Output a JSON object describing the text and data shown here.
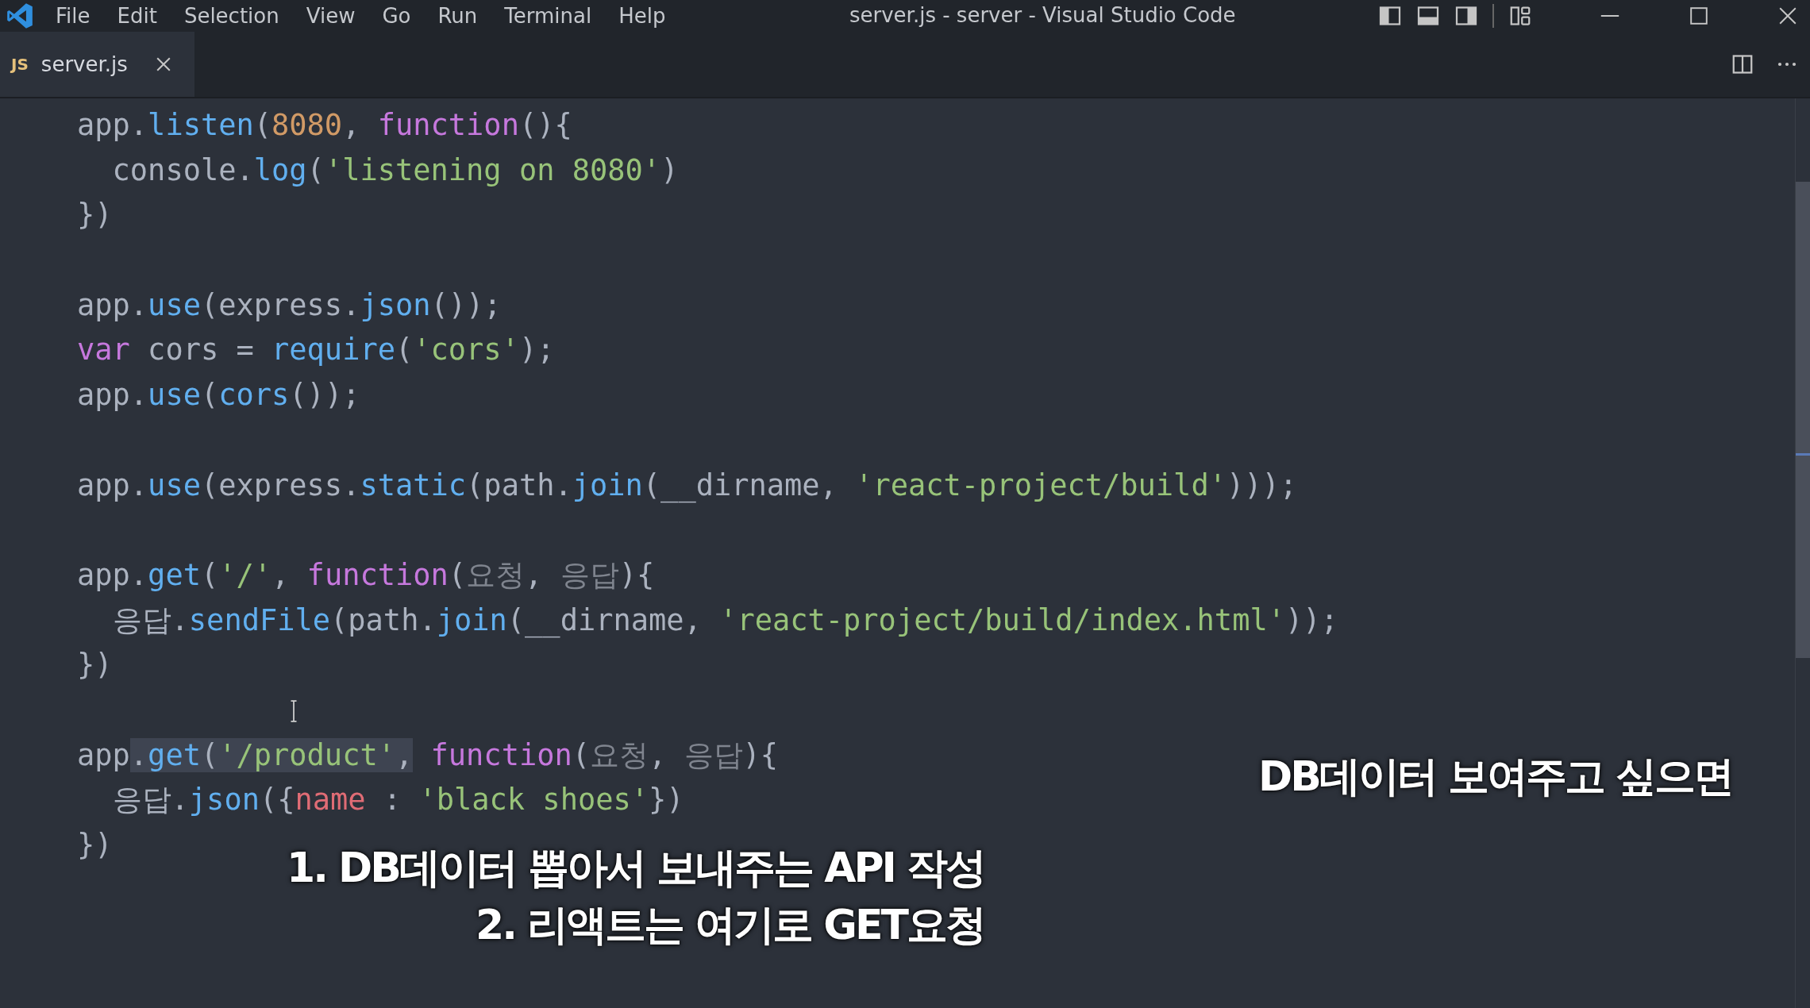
{
  "window": {
    "title": "server.js - server - Visual Studio Code"
  },
  "menu": [
    "File",
    "Edit",
    "Selection",
    "View",
    "Go",
    "Run",
    "Terminal",
    "Help"
  ],
  "tabs": [
    {
      "label": "server.js",
      "badge": "JS",
      "selected": true
    }
  ],
  "editor": {
    "lines": [
      {
        "kind": "code",
        "tokens": [
          {
            "kind": "plain",
            "text": "app."
          },
          {
            "kind": "fn",
            "text": "listen"
          },
          {
            "kind": "plain",
            "text": "("
          },
          {
            "kind": "num",
            "text": "8080"
          },
          {
            "kind": "plain",
            "text": ", "
          },
          {
            "kind": "kw",
            "text": "function"
          },
          {
            "kind": "plain",
            "text": "(){"
          }
        ]
      },
      {
        "kind": "code",
        "tokens": [
          {
            "kind": "plain",
            "text": "  console."
          },
          {
            "kind": "fn",
            "text": "log"
          },
          {
            "kind": "plain",
            "text": "("
          },
          {
            "kind": "str",
            "text": "'listening on 8080'"
          },
          {
            "kind": "plain",
            "text": ")"
          }
        ]
      },
      {
        "kind": "code",
        "tokens": [
          {
            "kind": "plain",
            "text": "})"
          }
        ]
      },
      {
        "kind": "blank"
      },
      {
        "kind": "code",
        "tokens": [
          {
            "kind": "plain",
            "text": "app."
          },
          {
            "kind": "fn",
            "text": "use"
          },
          {
            "kind": "plain",
            "text": "(express."
          },
          {
            "kind": "fn",
            "text": "json"
          },
          {
            "kind": "plain",
            "text": "());"
          }
        ]
      },
      {
        "kind": "code",
        "tokens": [
          {
            "kind": "kw",
            "text": "var"
          },
          {
            "kind": "plain",
            "text": " cors = "
          },
          {
            "kind": "fn",
            "text": "require"
          },
          {
            "kind": "plain",
            "text": "("
          },
          {
            "kind": "str",
            "text": "'cors'"
          },
          {
            "kind": "plain",
            "text": ");"
          }
        ]
      },
      {
        "kind": "code",
        "tokens": [
          {
            "kind": "plain",
            "text": "app."
          },
          {
            "kind": "fn",
            "text": "use"
          },
          {
            "kind": "plain",
            "text": "("
          },
          {
            "kind": "fn",
            "text": "cors"
          },
          {
            "kind": "plain",
            "text": "());"
          }
        ]
      },
      {
        "kind": "blank"
      },
      {
        "kind": "code",
        "tokens": [
          {
            "kind": "plain",
            "text": "app."
          },
          {
            "kind": "fn",
            "text": "use"
          },
          {
            "kind": "plain",
            "text": "(express."
          },
          {
            "kind": "fn",
            "text": "static"
          },
          {
            "kind": "plain",
            "text": "(path."
          },
          {
            "kind": "fn",
            "text": "join"
          },
          {
            "kind": "plain",
            "text": "(__dirname, "
          },
          {
            "kind": "str",
            "text": "'react-project/build'"
          },
          {
            "kind": "plain",
            "text": ")));"
          }
        ]
      },
      {
        "kind": "blank"
      },
      {
        "kind": "code",
        "tokens": [
          {
            "kind": "plain",
            "text": "app."
          },
          {
            "kind": "fn",
            "text": "get"
          },
          {
            "kind": "plain",
            "text": "("
          },
          {
            "kind": "str",
            "text": "'/'"
          },
          {
            "kind": "plain",
            "text": ", "
          },
          {
            "kind": "kw",
            "text": "function"
          },
          {
            "kind": "plain",
            "text": "("
          },
          {
            "kind": "param",
            "text": "요청"
          },
          {
            "kind": "plain",
            "text": ", "
          },
          {
            "kind": "param",
            "text": "응답"
          },
          {
            "kind": "plain",
            "text": "){"
          }
        ]
      },
      {
        "kind": "code",
        "tokens": [
          {
            "kind": "plain",
            "text": "  응답."
          },
          {
            "kind": "fn",
            "text": "sendFile"
          },
          {
            "kind": "plain",
            "text": "(path."
          },
          {
            "kind": "fn",
            "text": "join"
          },
          {
            "kind": "plain",
            "text": "(__dirname, "
          },
          {
            "kind": "str",
            "text": "'react-project/build/index.html'"
          },
          {
            "kind": "plain",
            "text": "));"
          }
        ]
      },
      {
        "kind": "code",
        "tokens": [
          {
            "kind": "plain",
            "text": "})"
          }
        ]
      },
      {
        "kind": "blank"
      },
      {
        "kind": "code",
        "tokens": [
          {
            "kind": "plain",
            "text": "app",
            "highlighted": false
          },
          {
            "kind": "plain",
            "text": ".",
            "highlighted": true
          },
          {
            "kind": "fn",
            "text": "get",
            "highlighted": true
          },
          {
            "kind": "plain",
            "text": "(",
            "highlighted": true
          },
          {
            "kind": "str",
            "text": "'/product'",
            "highlighted": true
          },
          {
            "kind": "plain",
            "text": ",",
            "highlighted": true
          },
          {
            "kind": "kw",
            "text": " function",
            "highlighted": false
          },
          {
            "kind": "plain",
            "text": "(",
            "highlighted": false
          },
          {
            "kind": "param",
            "text": "요청",
            "highlighted": false
          },
          {
            "kind": "plain",
            "text": ", ",
            "highlighted": false
          },
          {
            "kind": "param",
            "text": "응답",
            "highlighted": false
          },
          {
            "kind": "plain",
            "text": "){",
            "highlighted": false
          }
        ]
      },
      {
        "kind": "code",
        "tokens": [
          {
            "kind": "plain",
            "text": "  응답."
          },
          {
            "kind": "fn",
            "text": "json"
          },
          {
            "kind": "plain",
            "text": "({"
          },
          {
            "kind": "prop",
            "text": "name"
          },
          {
            "kind": "plain",
            "text": " : "
          },
          {
            "kind": "str",
            "text": "'black shoes'"
          },
          {
            "kind": "plain",
            "text": "})"
          }
        ]
      },
      {
        "kind": "code",
        "tokens": [
          {
            "kind": "plain",
            "text": "})"
          }
        ]
      }
    ]
  },
  "captions": {
    "side": "DB데이터 보여주고 싶으면",
    "bottom": [
      "1. DB데이터 뽑아서 보내주는 API 작성",
      "2. 리액트는 여기로 GET요청"
    ]
  }
}
